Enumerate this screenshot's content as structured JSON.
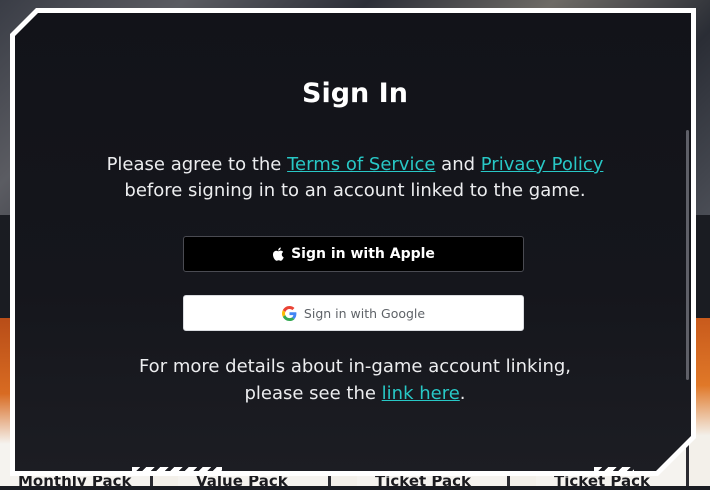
{
  "dialog": {
    "title": "Sign In",
    "agreement": {
      "before": "Please agree to the ",
      "terms_link": "Terms of Service",
      "and": " and ",
      "privacy_link": "Privacy Policy",
      "after": "before signing in to an account linked to the game."
    },
    "apple_button": {
      "label": "Sign in with Apple",
      "icon": "apple-icon"
    },
    "google_button": {
      "label": "Sign in with Google",
      "icon": "google-icon"
    },
    "details": {
      "line1": "For more details about in-game account linking,",
      "before_link": "please see the ",
      "link": "link here",
      "after_link": "."
    }
  },
  "background": {
    "cards": [
      {
        "label": "Monthly Pack"
      },
      {
        "label": "Value Pack"
      },
      {
        "label": "Ticket Pack"
      },
      {
        "label": "Ticket Pack"
      }
    ]
  },
  "colors": {
    "link": "#28c8c6",
    "dialog_bg": "#121319",
    "frame": "#ffffff"
  }
}
